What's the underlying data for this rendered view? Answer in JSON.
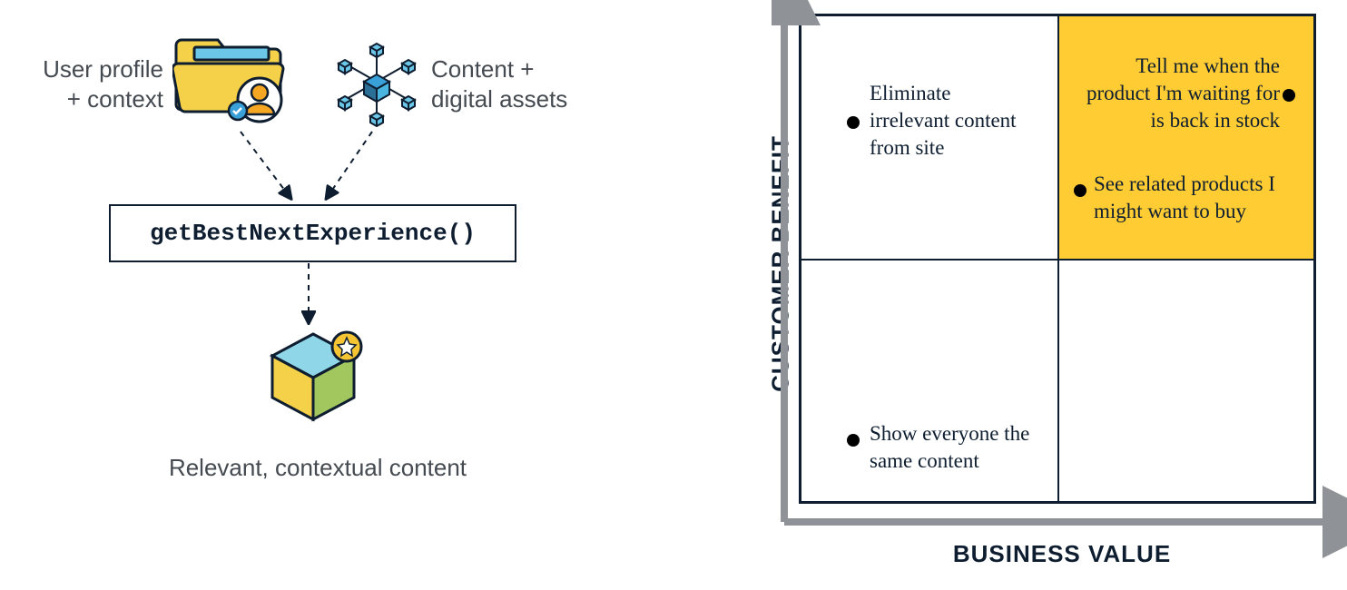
{
  "flow": {
    "input_left_label": "User profile\n+ context",
    "input_right_label": "Content +\ndigital assets",
    "function_name": "getBestNextExperience()",
    "output_label": "Relevant, contextual content"
  },
  "matrix": {
    "y_axis_label": "CUSTOMER BENEFIT",
    "x_axis_label": "BUSINESS VALUE",
    "highlight_quadrant": "top-right",
    "items": {
      "top_left": "Eliminate irrelevant content from site",
      "top_right_1": "Tell me when the product I'm waiting for is back in stock",
      "top_right_2": "See related products I might want to buy",
      "bottom_left": "Show everyone the same content"
    }
  },
  "colors": {
    "highlight": "#ffcc33",
    "border": "#0e1e30",
    "text": "#444a50"
  }
}
